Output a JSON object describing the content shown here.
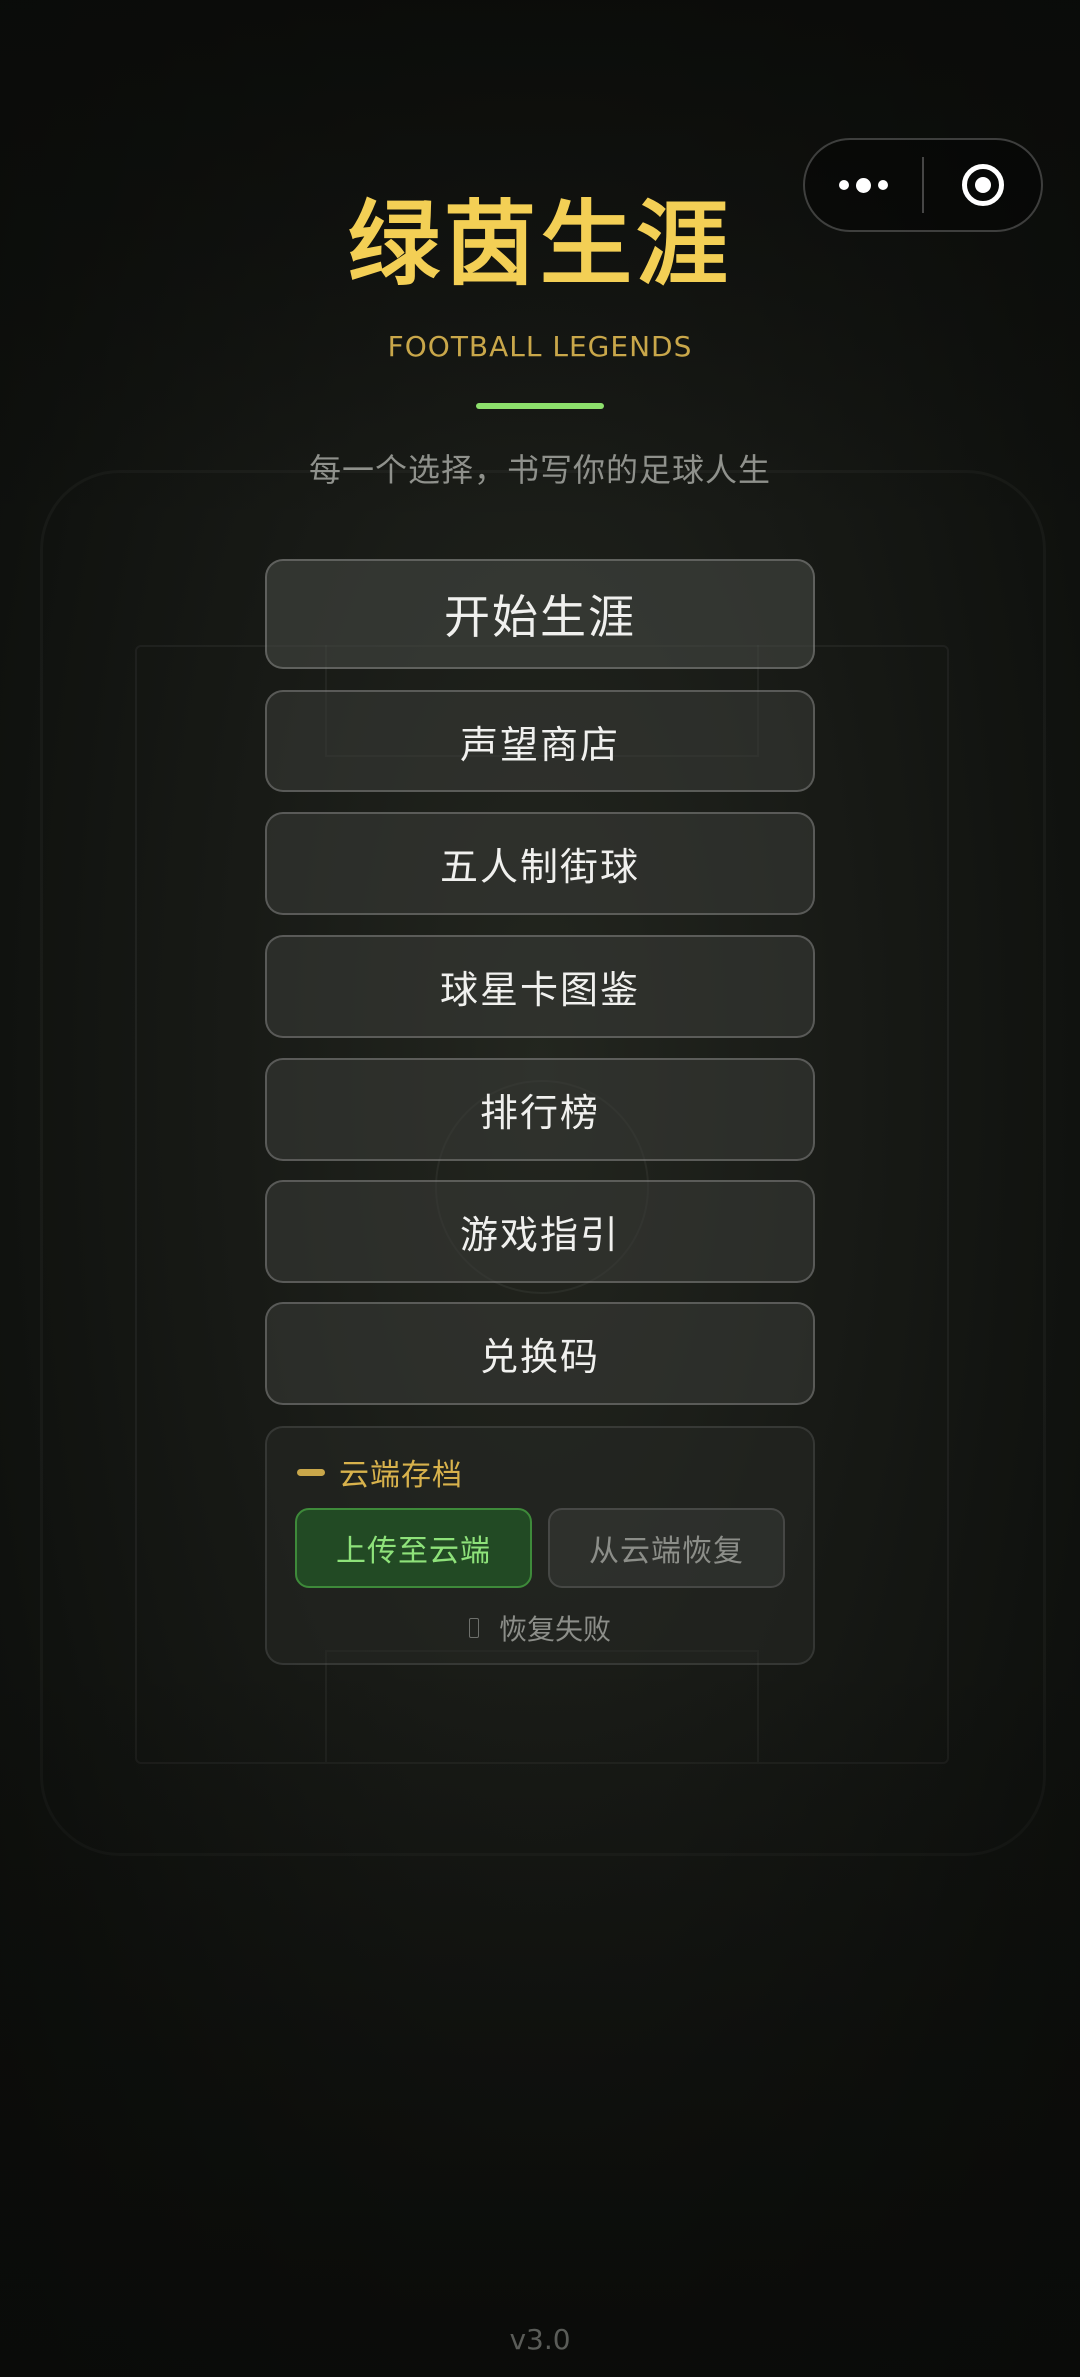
{
  "header": {
    "title": "绿茵生涯",
    "subtitle": "FOOTBALL LEGENDS",
    "tagline": "每一个选择，书写你的足球人生"
  },
  "capsule": {
    "more_icon": "more-dots-icon",
    "close_icon": "target-circle-icon"
  },
  "menu": {
    "start": "开始生涯",
    "shop": "声望商店",
    "street": "五人制街球",
    "cards": "球星卡图鉴",
    "ranking": "排行榜",
    "guide": "游戏指引",
    "redeem": "兑换码"
  },
  "cloud": {
    "title": "云端存档",
    "upload": "上传至云端",
    "restore": "从云端恢复",
    "status": "恢复失败"
  },
  "footer": {
    "version": "v3.0"
  },
  "colors": {
    "title": "#f3cf55",
    "accent": "#8de06c",
    "gold": "#c9a74a",
    "upload_bg": "#224a24"
  }
}
